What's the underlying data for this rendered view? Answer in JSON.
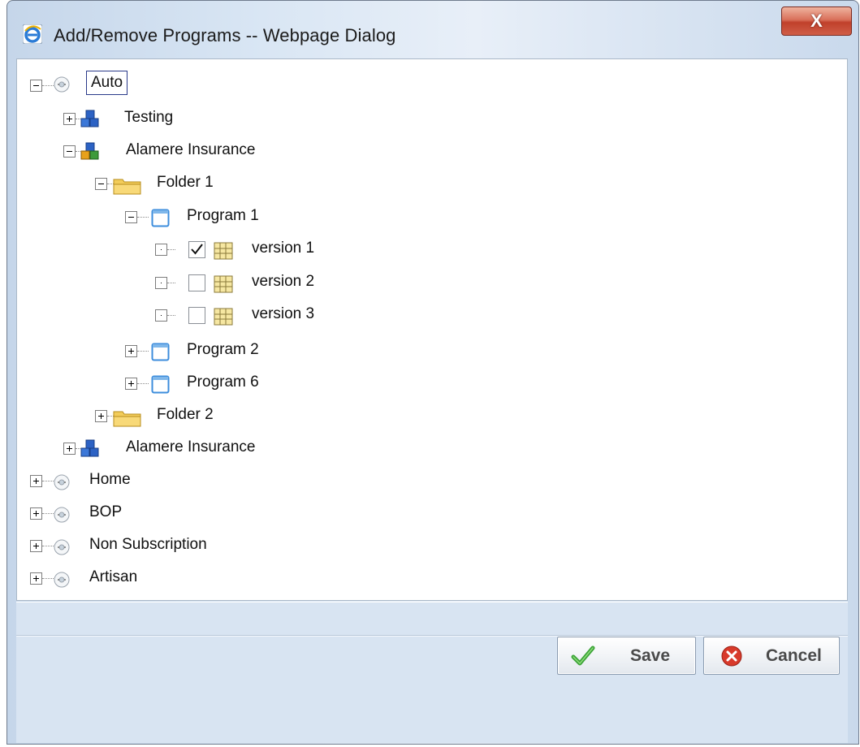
{
  "window": {
    "title": "Add/Remove Programs -- Webpage Dialog",
    "close_label": "X"
  },
  "tree": {
    "auto": "Auto",
    "testing": "Testing",
    "alamere_1": "Alamere Insurance",
    "folder_1": "Folder 1",
    "program_1": "Program 1",
    "version_1": "version 1",
    "version_2": "version 2",
    "version_3": "version 3",
    "program_2": "Program 2",
    "program_6": "Program 6",
    "folder_2": "Folder 2",
    "alamere_2": "Alamere Insurance",
    "home": "Home",
    "bop": "BOP",
    "non_subscription": "Non Subscription",
    "artisan": "Artisan"
  },
  "checks": {
    "version_1": true,
    "version_2": false,
    "version_3": false
  },
  "buttons": {
    "save": "Save",
    "cancel": "Cancel"
  },
  "colors": {
    "accent": "#2a3a8a",
    "save_icon": "#3aa336",
    "cancel_icon": "#d83a2b"
  }
}
